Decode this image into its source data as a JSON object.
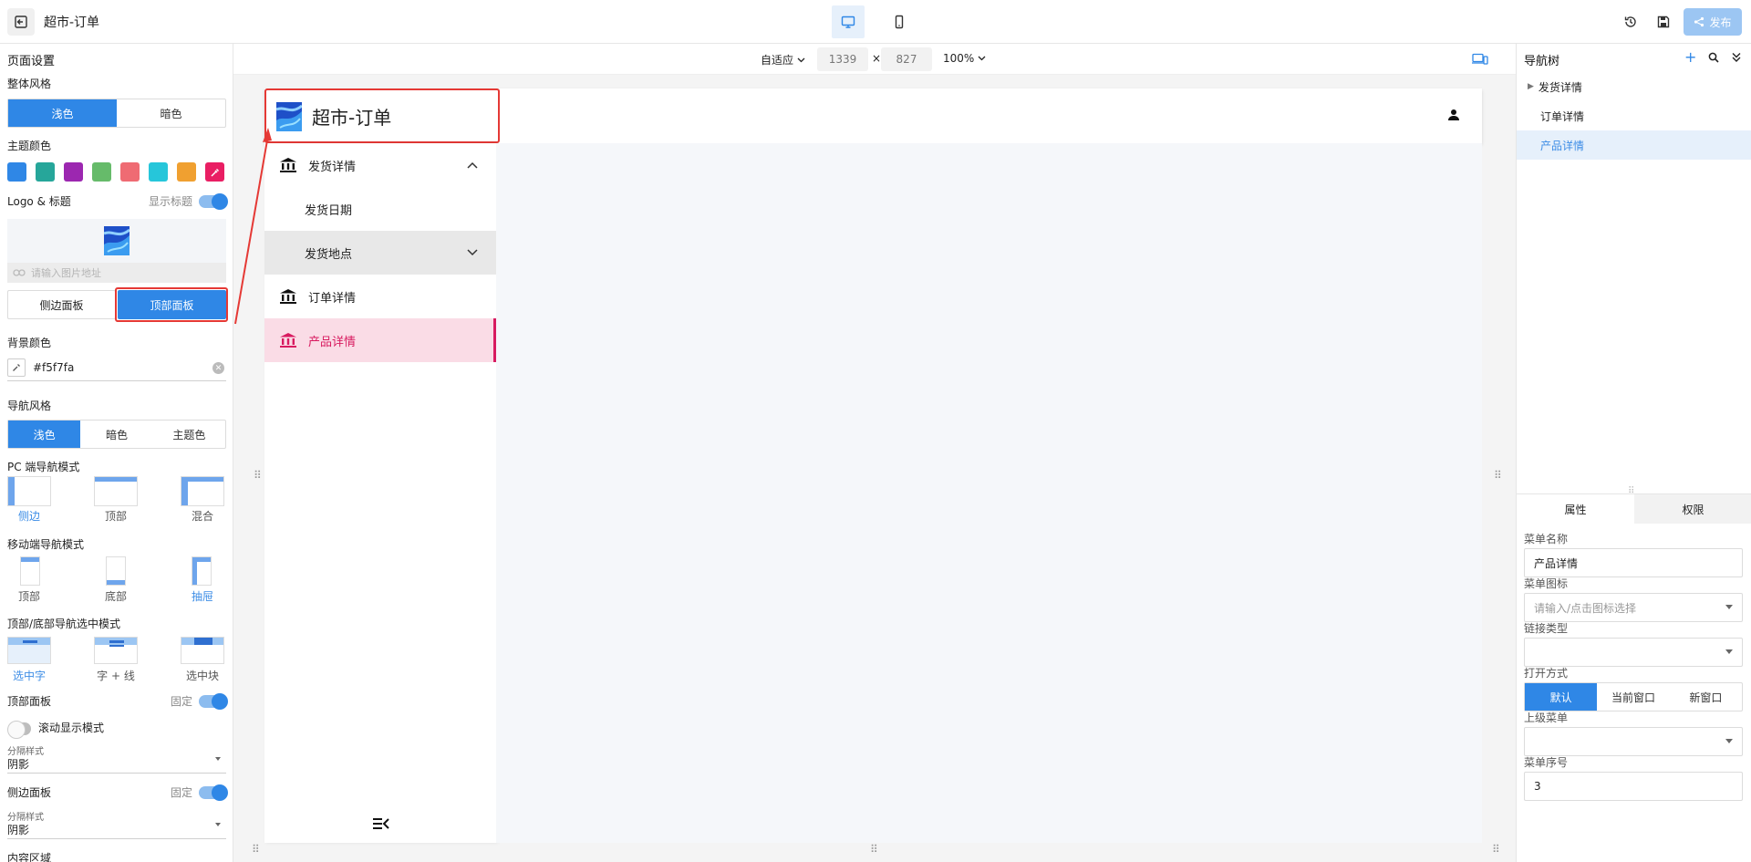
{
  "app": {
    "title": "超市-订单",
    "publish_label": "发布"
  },
  "left": {
    "page_settings": "页面设置",
    "overall_style": "整体风格",
    "style_light": "浅色",
    "style_dark": "暗色",
    "theme_color": "主题颜色",
    "theme_colors": [
      "#2f87e6",
      "#26a69a",
      "#9c27b0",
      "#66bb6a",
      "#ef6b73",
      "#26c6da",
      "#f0a030",
      "#e91e63"
    ],
    "logo_title": "Logo & 标题",
    "show_title": "显示标题",
    "image_placeholder": "请输入图片地址",
    "side_panel": "侧边面板",
    "top_panel": "顶部面板",
    "bg_color": "背景颜色",
    "bg_value": "#f5f7fa",
    "nav_style": "导航风格",
    "nav_light": "浅色",
    "nav_dark": "暗色",
    "nav_theme": "主题色",
    "pc_nav_mode": "PC 端导航模式",
    "pc_modes": [
      "侧边",
      "顶部",
      "混合"
    ],
    "mobile_nav_mode": "移动端导航模式",
    "mobile_modes": [
      "顶部",
      "底部",
      "抽屉"
    ],
    "select_mode": "顶部/底部导航选中模式",
    "select_modes": [
      "选中字",
      "字 + 线",
      "选中块"
    ],
    "top_panel_label": "顶部面板",
    "fixed": "固定",
    "scroll_mode": "滚动显示模式",
    "divider_style": "分隔样式",
    "divider_value": "阴影",
    "side_panel_label": "侧边面板",
    "fixed2": "固定",
    "divider_style2": "分隔样式",
    "divider_value2": "阴影",
    "content_area": "内容区域"
  },
  "canvas": {
    "fit": "自适应",
    "width": "1339",
    "times": "×",
    "height": "827",
    "zoom": "100%"
  },
  "preview": {
    "title": "超市-订单",
    "nav": {
      "shipping_details": "发货详情",
      "shipping_date": "发货日期",
      "shipping_location": "发货地点",
      "order_details": "订单详情",
      "product_details": "产品详情"
    }
  },
  "right": {
    "nav_tree": "导航树",
    "tree_items": [
      "发货详情",
      "订单详情",
      "产品详情"
    ],
    "tab_props": "属性",
    "tab_perm": "权限",
    "menu_name_label": "菜单名称",
    "menu_name_value": "产品详情",
    "menu_icon_label": "菜单图标",
    "menu_icon_placeholder": "请输入/点击图标选择",
    "link_type_label": "链接类型",
    "open_mode_label": "打开方式",
    "open_modes": [
      "默认",
      "当前窗口",
      "新窗口"
    ],
    "parent_menu_label": "上级菜单",
    "menu_order_label": "菜单序号",
    "menu_order_value": "3"
  }
}
